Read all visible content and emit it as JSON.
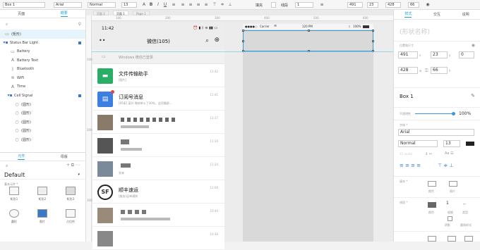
{
  "toolbar": {
    "element_name": "Box 1",
    "font": "Arial",
    "weight": "Normal",
    "size": "13",
    "fill_label": "填充",
    "line_label": "线段",
    "line_width": "1",
    "x": "491",
    "y": "23",
    "w": "428",
    "h": "66"
  },
  "left_panel": {
    "tab_pages": "页面",
    "tab_outline": "概要",
    "layers": [
      "(矩形)",
      "Status Bar Light",
      "Battery",
      "Battery Text",
      "Bluetooth",
      "WiFi",
      "Time",
      "Cell Signal",
      "(圆形)",
      "(圆形)",
      "(圆形)",
      "(圆形)",
      "(圆形)"
    ],
    "lib_tab_components": "元件",
    "lib_tab_masters": "母版",
    "library": "Default",
    "lib_section": "基本元件 *",
    "components": [
      "矩形1",
      "矩形2",
      "矩形3",
      "圆形",
      "图片",
      "占位符"
    ]
  },
  "canvas": {
    "tabs": [
      "页面 2",
      "页面 1",
      "Page 1"
    ],
    "ruler_h": [
      "100",
      "200",
      "300",
      "400",
      "500",
      "600"
    ],
    "ruler_v": [
      "100",
      "200",
      "300"
    ]
  },
  "phone": {
    "time": "11:42",
    "title": "微信(105)",
    "notice": "Windows 微信已登录",
    "chats": [
      {
        "name": "文件传输助手",
        "sub": "[图片]",
        "time": "11:42",
        "color": "#2aae67"
      },
      {
        "name": "订阅号消息",
        "sub": "[95条] 某外 微软带火了30年，这项霸屏...",
        "time": "11:41",
        "color": "#3c7fe0"
      },
      {
        "name": "",
        "sub": "",
        "time": "11:37",
        "color": "#8a7a6a"
      },
      {
        "name": "",
        "sub": "",
        "time": "11:30",
        "color": "#555"
      },
      {
        "name": "",
        "sub": "发来",
        "time": "11:24",
        "color": "#7a8a99"
      },
      {
        "name": "顺丰速运",
        "sub": "[服务]运单通知",
        "time": "11:00",
        "color": "#222"
      },
      {
        "name": "",
        "sub": "",
        "time": "10:40",
        "color": "#9a8a7a"
      },
      {
        "name": "",
        "sub": "",
        "time": "10:36",
        "color": "#888"
      }
    ]
  },
  "artboard": {
    "carrier": "Carrier",
    "time": "120 PM",
    "battery": "100%"
  },
  "right_panel": {
    "tab_style": "样式",
    "tab_interaction": "交互",
    "tab_notes": "说明",
    "shape_name": "(形状名称)",
    "pos_label": "位置和尺寸",
    "x": "491",
    "y": "23",
    "rot": "0",
    "w": "428",
    "h": "66",
    "box_name": "Box 1",
    "opacity_label": "不透明性",
    "opacity": "100%",
    "opacity_value": 1,
    "font_label": "字体 *",
    "font": "Arial",
    "weight": "Normal",
    "size": "13",
    "spacing_label": "15 (auto)",
    "fill_label": "填充 *",
    "line_label": "线段 *",
    "line_width": "1",
    "fill_opts": [
      "颜色",
      "图片"
    ],
    "line_opts": [
      "颜色",
      "粗细",
      "类型"
    ],
    "effect_opts": [
      "阴影",
      "圆角样式"
    ]
  }
}
